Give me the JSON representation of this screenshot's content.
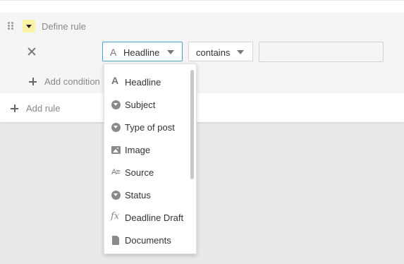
{
  "rule": {
    "title": "Define rule",
    "condition": {
      "field": "Headline",
      "field_icon": "A",
      "operator": "contains",
      "value": ""
    },
    "add_condition_label": "Add condition",
    "add_rule_label": "Add rule"
  },
  "dropdown": {
    "items": [
      {
        "label": "Headline",
        "icon": "text-icon"
      },
      {
        "label": "Subject",
        "icon": "single-select-icon"
      },
      {
        "label": "Type of post",
        "icon": "single-select-icon"
      },
      {
        "label": "Image",
        "icon": "image-icon"
      },
      {
        "label": "Source",
        "icon": "long-text-icon"
      },
      {
        "label": "Status",
        "icon": "single-select-icon"
      },
      {
        "label": "Deadline Draft",
        "icon": "formula-icon"
      },
      {
        "label": "Documents",
        "icon": "document-icon"
      }
    ]
  },
  "colors": {
    "toggle_bg": "#fcf3a8",
    "focus_border": "#4aa0d6"
  }
}
